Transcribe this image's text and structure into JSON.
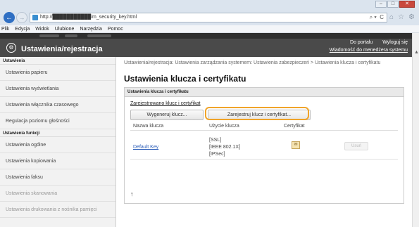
{
  "browser": {
    "url": "http://███████████/m_security_key.html",
    "url_tools": "⌕ ▾  C",
    "menu": [
      "Plik",
      "Edycja",
      "Widok",
      "Ulubione",
      "Narzędzia",
      "Pomoc"
    ]
  },
  "header": {
    "title": "Ustawienia/rejestracja",
    "portal_link": "Do portalu",
    "logout_link": "Wyloguj się",
    "manager_link": "Wiadomość do menedżera systemu"
  },
  "sidebar": {
    "sections": [
      {
        "title": "Ustawienia",
        "items": [
          "Ustawienia papieru",
          "Ustawienia wyświetlania",
          "Ustawienia włącznika czasowego",
          "Regulacja poziomu głośności"
        ]
      },
      {
        "title": "Ustawienia funkcji",
        "items": [
          "Ustawienia ogólne",
          "Ustawienia kopiowania",
          "Ustawienia faksu",
          "Ustawienia skanowania",
          "Ustawienia drukowania z nośnika pamięci"
        ]
      }
    ]
  },
  "main": {
    "breadcrumb": "Ustawienia/rejestracja: Ustawienia zarządzania systemem: Ustawienia zabezpieczeń > Ustawienia klucza i certyfikatu",
    "title": "Ustawienia klucza i certyfikatu",
    "panel_title": "Ustawienia klucza i certyfikatu",
    "registered_heading": "Zarejestrowano klucz i certyfikat",
    "generate_button": "Wygeneruj klucz...",
    "register_button": "Zarejestruj klucz i certyfikat...",
    "columns": [
      "Nazwa klucza",
      "Użycie klucza",
      "Certyfikat"
    ],
    "rows": [
      {
        "key_name": "Default Key",
        "usage": [
          "[SSL]",
          "[IEEE 802.1X]",
          "[IPSec]"
        ],
        "delete_label": "Usuń"
      }
    ],
    "top_icon": "↑"
  }
}
